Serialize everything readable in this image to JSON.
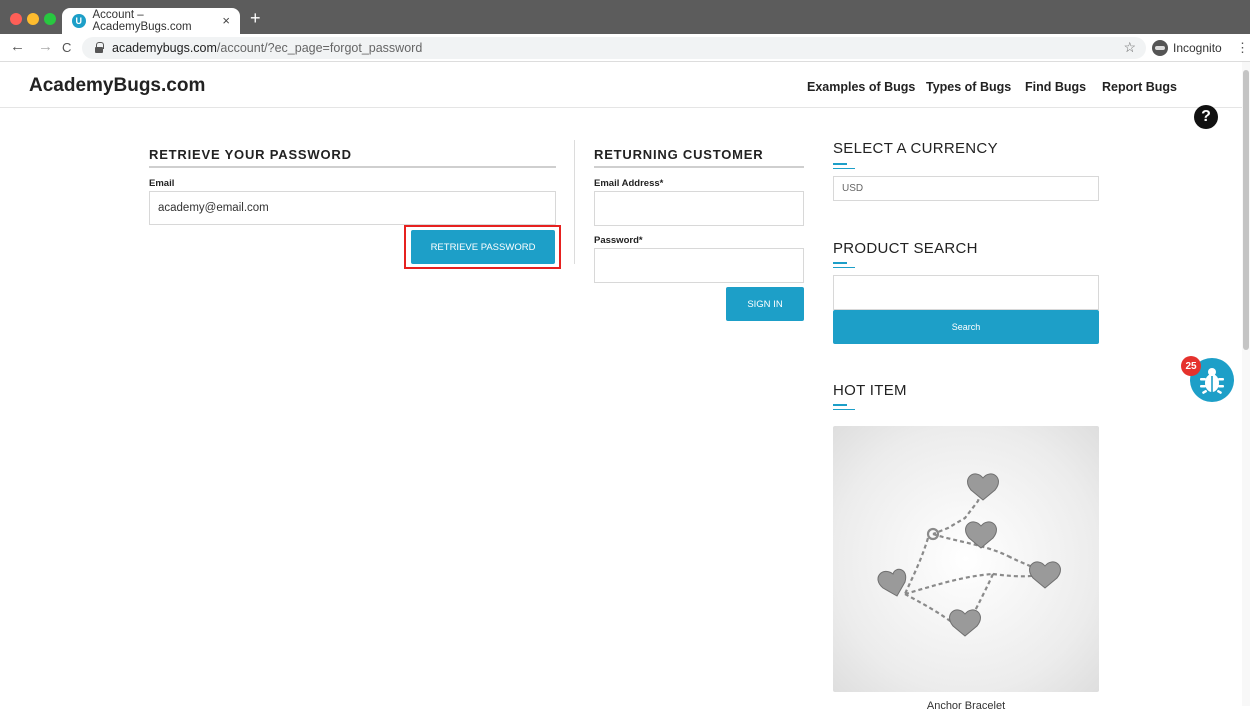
{
  "browser": {
    "tab_title": "Account – AcademyBugs.com",
    "tab_favicon": "U",
    "tab_close": "×",
    "new_tab": "+",
    "back": "←",
    "forward": "→",
    "reload": "C",
    "url_host": "academybugs.com",
    "url_path": "/account/?ec_page=forgot_password",
    "star": "☆",
    "incognito_label": "Incognito",
    "menu": "⋮"
  },
  "header": {
    "logo": "AcademyBugs.com",
    "nav": [
      "Examples of Bugs",
      "Types of Bugs",
      "Find Bugs",
      "Report Bugs"
    ],
    "help": "?"
  },
  "retrieve": {
    "title": "RETRIEVE YOUR PASSWORD",
    "email_label": "Email",
    "email_value": "academy@email.com",
    "button": "RETRIEVE PASSWORD"
  },
  "returning": {
    "title": "RETURNING CUSTOMER",
    "email_label": "Email Address*",
    "password_label": "Password*",
    "button": "SIGN IN"
  },
  "sidebar": {
    "currency_title": "SELECT A CURRENCY",
    "currency_value": "USD",
    "search_title": "PRODUCT SEARCH",
    "search_button": "Search",
    "hot_title": "HOT ITEM",
    "product_name": "Anchor Bracelet"
  },
  "bug_widget": {
    "count": "25"
  },
  "colors": {
    "accent": "#1d9fc8",
    "highlight": "#e6211f",
    "badge": "#e5322d"
  }
}
